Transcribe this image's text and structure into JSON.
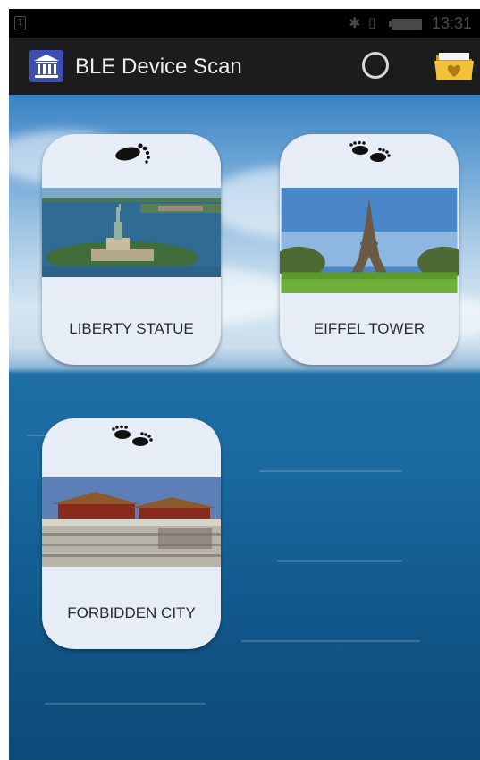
{
  "status_bar": {
    "sim_slot": "1",
    "time": "13:31"
  },
  "action_bar": {
    "title": "BLE Device Scan",
    "app_icon": "museum-building-icon",
    "scan_indicator": "progress-ring-icon",
    "favorites_icon": "heart-folder-icon"
  },
  "devices": [
    {
      "label": "LIBERTY STATUE",
      "icon": "footprints-icon",
      "photo": "liberty-statue-photo"
    },
    {
      "label": "EIFFEL TOWER",
      "icon": "footprints-icon",
      "photo": "eiffel-tower-photo"
    },
    {
      "label": "FORBIDDEN CITY",
      "icon": "footprints-icon",
      "photo": "forbidden-city-photo"
    }
  ],
  "colors": {
    "action_bar_bg": "#1c1c1c",
    "card_bg": "#e6edf6",
    "app_icon_bg": "#3d4fb5"
  }
}
